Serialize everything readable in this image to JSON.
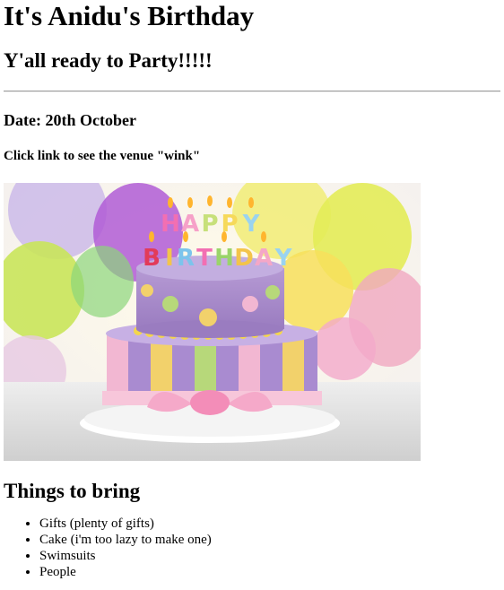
{
  "header": {
    "title": "It's Anidu's Birthday",
    "subtitle": "Y'all ready to Party!!!!!"
  },
  "details": {
    "date": "Date: 20th October",
    "venue_link": "Click link to see the venue \"wink\""
  },
  "image": {
    "cake_text": "HAPPY BIRTHDAY"
  },
  "things": {
    "heading": "Things to bring",
    "items": [
      "Gifts (plenty of gifts)",
      "Cake (i'm too lazy to make one)",
      "Swimsuits",
      "People"
    ]
  }
}
